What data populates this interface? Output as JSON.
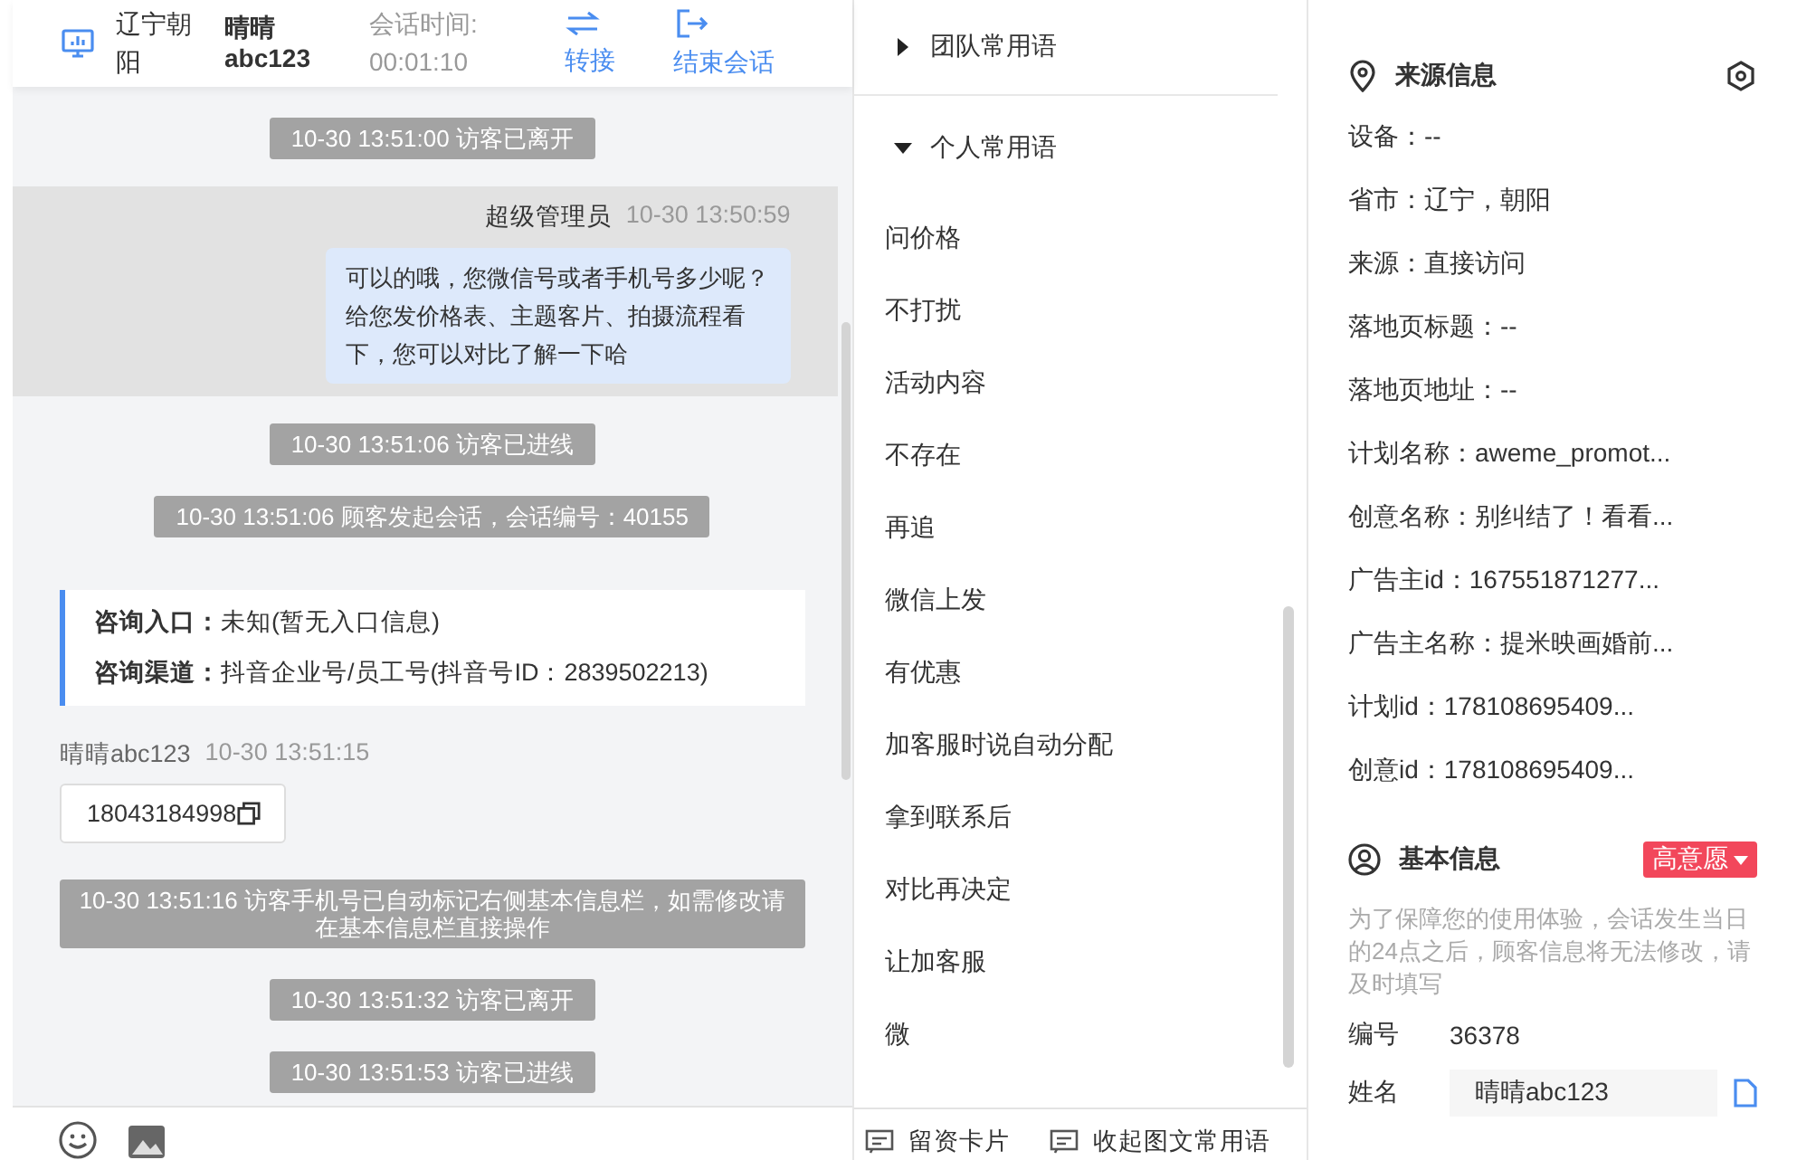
{
  "header": {
    "location": "辽宁朝阳",
    "visitor": "晴晴",
    "visitor_id": "abc123",
    "duration_label": "会话时间:",
    "duration": "00:01:10",
    "actions": [
      {
        "label": "转接",
        "kind": "transfer"
      },
      {
        "label": "结束会话",
        "kind": "end"
      }
    ]
  },
  "messages": [
    {
      "kind": "system",
      "text": "10-30 13:51:00 访客已离开"
    },
    {
      "kind": "agent",
      "sender": "超级管理员",
      "time": "10-30 13:50:59",
      "text": "可以的哦，您微信号或者手机号多少呢？给您发价格表、主题客片、拍摄流程看下，您可以对比了解一下哈",
      "highlighted": true
    },
    {
      "kind": "system",
      "text": "10-30 13:51:06 访客已进线"
    },
    {
      "kind": "system",
      "text": "10-30 13:51:06 顾客发起会话，会话编号：40155"
    },
    {
      "kind": "info",
      "lines": [
        {
          "label": "咨询入口：",
          "value": "未知(暂无入口信息)"
        },
        {
          "label": "咨询渠道：",
          "value": "抖音企业号/员工号(抖音号ID：2839502213)"
        }
      ]
    },
    {
      "kind": "visitor",
      "sender": "晴晴abc123",
      "time": "10-30 13:51:15",
      "text": "18043184998"
    },
    {
      "kind": "system",
      "text": "10-30 13:51:16 访客手机号已自动标记右侧基本信息栏，如需修改请在基本信息栏直接操作"
    },
    {
      "kind": "system",
      "text": "10-30 13:51:32 访客已离开"
    },
    {
      "kind": "system",
      "text": "10-30 13:51:53 访客已进线"
    }
  ],
  "phrases": {
    "groups": [
      {
        "label": "团队常用语",
        "expanded": false
      },
      {
        "label": "个人常用语",
        "expanded": true,
        "items": [
          "问价格",
          "不打扰",
          "活动内容",
          "不存在",
          "再追",
          "微信上发",
          "有优惠",
          "加客服时说自动分配",
          "拿到联系后",
          "对比再决定",
          "让加客服",
          "微"
        ]
      }
    ],
    "actions": [
      {
        "label": "留资卡片"
      },
      {
        "label": "收起图文常用语"
      }
    ]
  },
  "source_info": {
    "title": "来源信息",
    "fields": [
      "设备：--",
      "省市：辽宁，朝阳",
      "来源：直接访问",
      "落地页标题：--",
      "落地页地址：--",
      "计划名称：aweme_promot...",
      "创意名称：别纠结了！看看...",
      "广告主id：167551871277...",
      "广告主名称：提米映画婚前...",
      "计划id：178108695409...",
      "创意id：178108695409..."
    ]
  },
  "basic_info": {
    "title": "基本信息",
    "tag": "高意愿",
    "note": "为了保障您的使用体验，会话发生当日的24点之后，顾客信息将无法修改，请及时填写",
    "fields": [
      {
        "label": "编号",
        "value": "36378",
        "kind": "text"
      },
      {
        "label": "姓名",
        "value": "晴晴abc123",
        "kind": "input"
      }
    ]
  }
}
